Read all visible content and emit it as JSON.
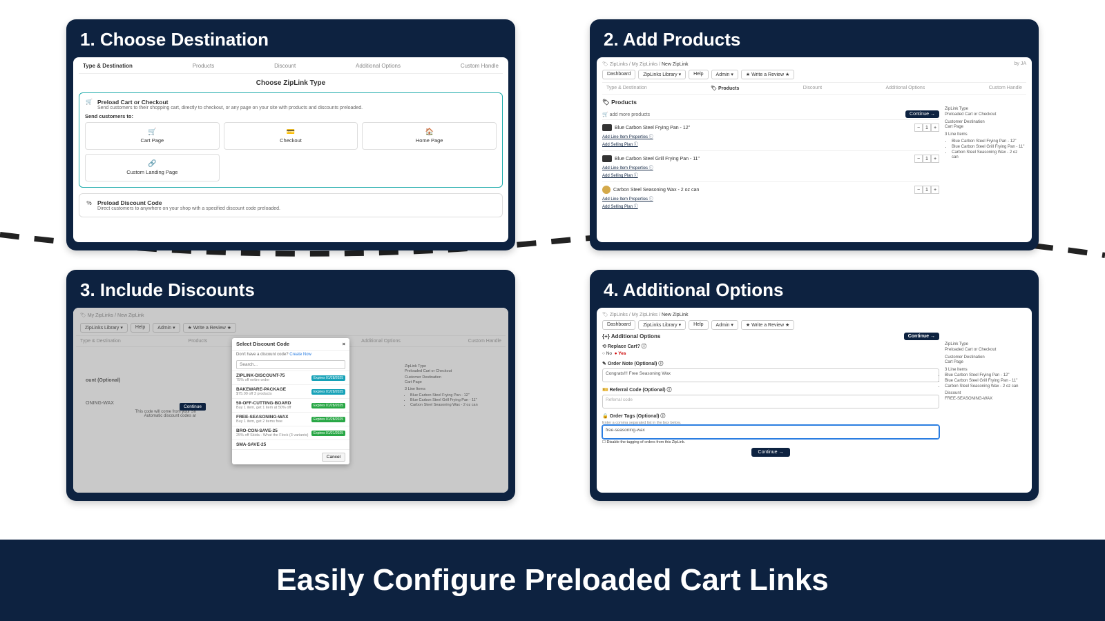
{
  "footer": "Easily Configure Preloaded Cart Links",
  "panels": {
    "p1": {
      "title": "1.  Choose Destination",
      "tabs": [
        "Type & Destination",
        "Products",
        "Discount",
        "Additional Options",
        "Custom Handle"
      ],
      "heading": "Choose ZipLink Type",
      "box1": {
        "title": "Preload Cart or Checkout",
        "desc": "Send customers to their shopping cart, directly to checkout, or any page on your site with products and discounts preloaded.",
        "prompt": "Send customers to:",
        "cards": [
          "Cart Page",
          "Checkout",
          "Home Page",
          "Custom Landing Page"
        ]
      },
      "box2": {
        "title": "Preload Discount Code",
        "desc": "Direct customers to anywhere on your shop with a specified discount code preloaded."
      }
    },
    "p2": {
      "title": "2.  Add Products",
      "crumb": [
        "ZipLinks",
        "My ZipLinks",
        "New ZipLink"
      ],
      "buttons": [
        "Dashboard",
        "ZipLinks Library ▾",
        "Help",
        "Admin ▾",
        "★ Write a Review ★"
      ],
      "tabs": [
        "Type & Destination",
        "Products",
        "Discount",
        "Additional Options",
        "Custom Handle"
      ],
      "section": "Products",
      "addmore": "add more products",
      "continue": "Continue →",
      "products": [
        {
          "name": "Blue Carbon Steel Frying Pan - 12\"",
          "qty": 1
        },
        {
          "name": "Blue Carbon Steel Grill Frying Pan - 11\"",
          "qty": 1
        },
        {
          "name": "Carbon Steel Seasoning Wax - 2 oz can",
          "qty": 1
        }
      ],
      "sublinks": [
        "Add Line Item Properties ⓘ",
        "Add Selling Plan ⓘ"
      ],
      "summary": {
        "type_l": "ZipLink Type",
        "type_v": "Preloaded Cart or Checkout",
        "dest_l": "Customer Destination",
        "dest_v": "Cart Page",
        "items_l": "3 Line Items",
        "items": [
          "Blue Carbon Steel Frying Pan - 12\"",
          "Blue Carbon Steel Grill Frying Pan - 11\"",
          "Carbon Steel Seasoning Wax - 2 oz can"
        ]
      }
    },
    "p3": {
      "title": "3.  Include Discounts",
      "crumb": "My ZipLinks / New ZipLink",
      "buttons": [
        "ZipLinks Library ▾",
        "Help",
        "Admin ▾",
        "★ Write a Review ★"
      ],
      "modal": {
        "title": "Select Discount Code",
        "prompt": "Don't have a discount code?",
        "create": "Create Now",
        "search": "Search...",
        "codes": [
          {
            "name": "ZIPLINK-DISCOUNT-75",
            "desc": "75% off entire order",
            "badge": "Expires 01/28/2025",
            "cls": "b"
          },
          {
            "name": "BAKEWARE-PACKAGE",
            "desc": "$75.00 off 3 products",
            "badge": "Expires 01/28/2025",
            "cls": "b"
          },
          {
            "name": "50-OFF-CUTTING-BOARD",
            "desc": "Buy 1 item, get 1 item at 50% off",
            "badge": "Expires 01/28/2025",
            "cls": ""
          },
          {
            "name": "FREE-SEASONING-WAX",
            "desc": "Buy 1 item, get 2 items free",
            "badge": "Expires 01/28/2025",
            "cls": ""
          },
          {
            "name": "BRO-CON-SAVE-25",
            "desc": "25% off Skida - What the Flock (3 variants)",
            "badge": "Expires 01/21/2025",
            "cls": ""
          },
          {
            "name": "SMA-SAVE-25",
            "desc": "",
            "badge": "",
            "cls": ""
          }
        ],
        "cancel": "Cancel"
      },
      "bgtext": {
        "ount": "ount (Optional)",
        "wax": "ONING-WAX",
        "line1": "This code will come from your Sh",
        "line2": "Automatic discount codes ar",
        "cont": "Continue"
      },
      "summary": {
        "type_l": "ZipLink Type",
        "type_v": "Preloaded Cart or Checkout",
        "dest_l": "Customer Destination",
        "dest_v": "Cart Page",
        "items_l": "3 Line Items",
        "items": [
          "Blue Carbon Steel Frying Pan - 12\"",
          "Blue Carbon Steel Grill Frying Pan - 11\"",
          "Carbon Steel Seasoning Wax - 2 oz can"
        ]
      }
    },
    "p4": {
      "title": "4.  Additional Options",
      "crumb": [
        "ZipLinks",
        "My ZipLinks",
        "New ZipLink"
      ],
      "buttons": [
        "Dashboard",
        "ZipLinks Library ▾",
        "Help",
        "Admin ▾",
        "★ Write a Review ★"
      ],
      "header": "{+} Additional Options",
      "continue": "Continue →",
      "replace": {
        "label": "Replace Cart? ⓘ",
        "no": "○ No",
        "yes": "● Yes"
      },
      "note": {
        "label": "Order Note (Optional) ⓘ",
        "value": "Congrats!!! Free Seasoning Wax"
      },
      "ref": {
        "label": "Referral Code (Optional) ⓘ",
        "placeholder": "Referral code"
      },
      "tags": {
        "label": "Order Tags (Optional) ⓘ",
        "desc": "Enter a comma separated list in the box below.",
        "value": "free-seasoning-wax",
        "disable": "Disable the tagging of orders from this ZipLink."
      },
      "cont2": "Continue →",
      "summary": {
        "type_l": "ZipLink Type",
        "type_v": "Preloaded Cart or Checkout",
        "dest_l": "Customer Destination",
        "dest_v": "Cart Page",
        "items_l": "3 Line Items",
        "items": [
          "Blue Carbon Steel Frying Pan - 12\"",
          "Blue Carbon Steel Grill Frying Pan - 11\"",
          "Carbon Steel Seasoning Wax - 2 oz can"
        ],
        "disc_l": "Discount",
        "disc_v": "FREE-SEASONING-WAX"
      }
    }
  }
}
